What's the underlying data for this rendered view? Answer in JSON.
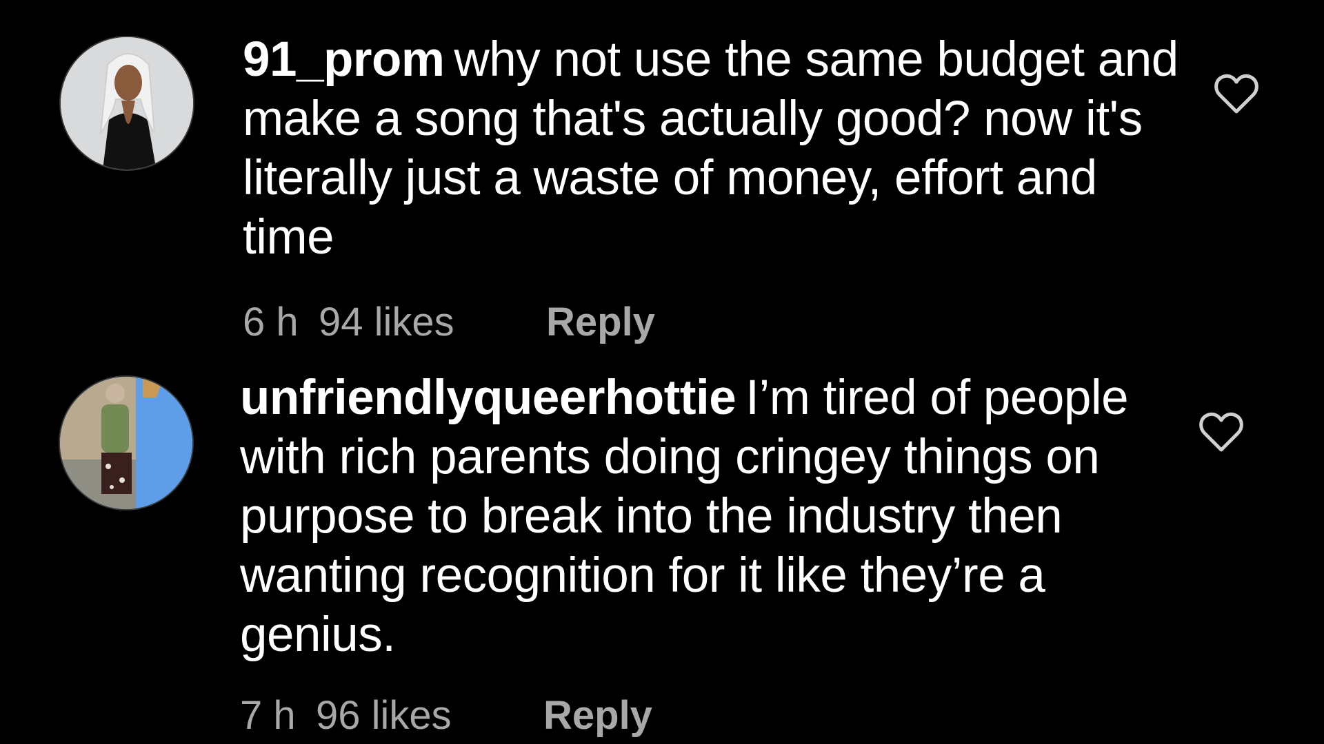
{
  "comments": [
    {
      "username": "91_prom",
      "text": "why not use the same budget and make a song that's actually good? now it's literally just a waste of money, effort and time",
      "time": "6 h",
      "likes": "94 likes",
      "reply_label": "Reply",
      "avatar_icon": "avatar-illustrated-woman-icon",
      "like_icon": "heart-outline-icon"
    },
    {
      "username": "unfriendlyqueerhottie",
      "text": "I’m tired of people with rich parents doing cringey things on purpose to break into the industry then wanting recognition for it like they’re a genius.",
      "time": "7 h",
      "likes": "96 likes",
      "reply_label": "Reply",
      "avatar_icon": "avatar-photo-person-icon",
      "like_icon": "heart-outline-icon"
    }
  ],
  "colors": {
    "background": "#000000",
    "text": "#ffffff",
    "meta_text": "#a8a8a8"
  }
}
